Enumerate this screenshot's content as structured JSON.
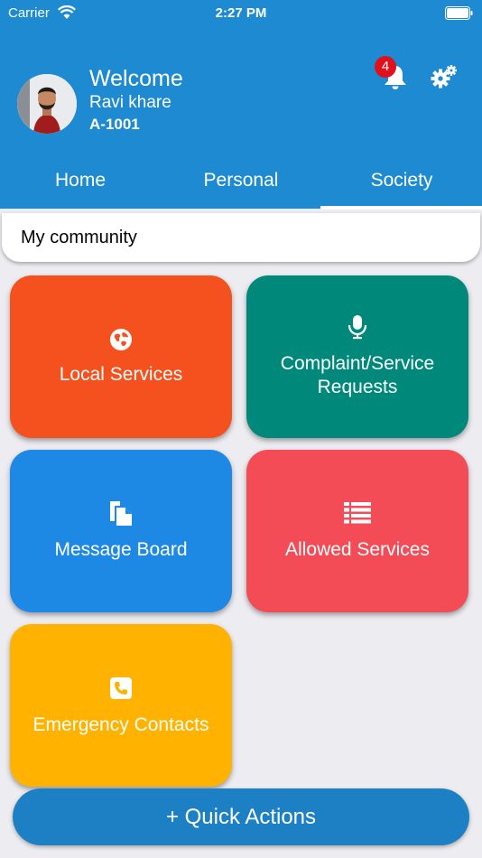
{
  "status_bar": {
    "carrier": "Carrier",
    "time": "2:27 PM"
  },
  "header": {
    "welcome": "Welcome",
    "user_name": "Ravi khare",
    "flat": "A-1001",
    "notification_count": "4"
  },
  "tabs": [
    {
      "label": "Home"
    },
    {
      "label": "Personal"
    },
    {
      "label": "Society",
      "active": true
    }
  ],
  "section_title": "My community",
  "tiles": [
    {
      "label": "Local Services",
      "icon": "globe-icon",
      "color": "#f4511e"
    },
    {
      "label": "Complaint/Service Requests",
      "icon": "microphone-icon",
      "color": "#00897b"
    },
    {
      "label": "Message Board",
      "icon": "documents-icon",
      "color": "#1e88e5"
    },
    {
      "label": "Allowed Services",
      "icon": "list-icon",
      "color": "#f44c56"
    },
    {
      "label": "Emergency Contacts",
      "icon": "phone-icon",
      "color": "#ffb300"
    }
  ],
  "quick_actions": "+ Quick Actions",
  "colors": {
    "primary": "#1e8ad2",
    "background": "#ececf1",
    "badge": "#e0101c"
  }
}
